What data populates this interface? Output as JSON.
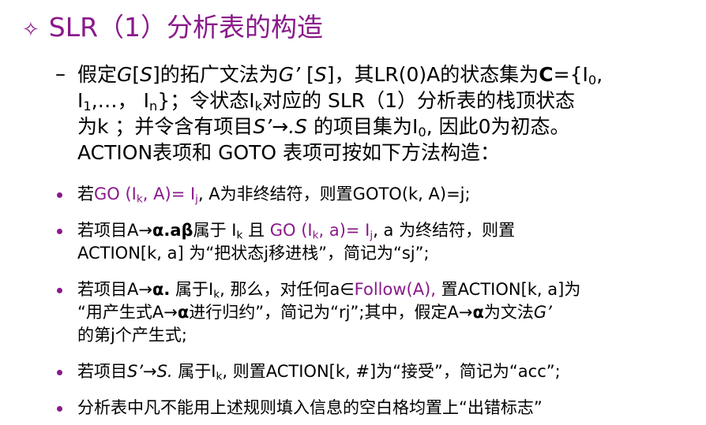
{
  "title": {
    "icon": "diamond-outline-icon",
    "text": "SLR（1）分析表的构造"
  },
  "intro": {
    "bullet": "–",
    "lines": [
      [
        "假定",
        "G",
        "[",
        "S",
        "]的拓广文法为",
        "G’",
        " [",
        "S",
        "]，其LR(0)A的状态集为",
        "C",
        "={I",
        "0",
        ","
      ],
      [
        "I",
        "1",
        ",…， I",
        "n",
        "}；令状态I",
        "k",
        "对应的 SLR（1）分析表的栈顶状态"
      ],
      [
        "为k ；并令含有项目",
        "S’→.S",
        " 的项目集为I",
        "0",
        ", 因此0为初态。"
      ],
      [
        "ACTION表项和 GOTO 表项可按如下方法构造："
      ]
    ]
  },
  "bullets": [
    {
      "lines": [
        [
          "若",
          "GO (I",
          "k",
          ", A)= I",
          "j",
          ", A为非终结符，则置GOTO(k, A)=j;"
        ]
      ]
    },
    {
      "lines": [
        [
          "若项目A→",
          "α.aβ",
          "属于 I",
          "k",
          " 且 ",
          "GO (I",
          "k",
          ", a)= I",
          "j",
          ", a 为终结符，则置"
        ],
        [
          "ACTION[k, a] 为“把状态j移进栈”，简记为“sj”;"
        ]
      ]
    },
    {
      "lines": [
        [
          "若项目A→",
          "α.",
          " 属于I",
          "k",
          ", 那么，对任何a∈",
          "Follow(A),",
          " 置ACTION[k, a]为"
        ],
        [
          "“用产生式A→",
          "α",
          "进行归约”，简记为“rj”;其中，假定A→",
          "α",
          "为文法",
          "G’"
        ],
        [
          "的第j个产生式;"
        ]
      ]
    },
    {
      "lines": [
        [
          "若项目",
          "S’→S.",
          " 属于I",
          "k",
          ", 则置ACTION[k, #]为“接受”，简记为“acc”;"
        ]
      ]
    },
    {
      "lines": [
        [
          "分析表中凡不能用上述规则填入信息的空白格均置上“出错标志”"
        ]
      ]
    }
  ],
  "colors": {
    "accent": "#8a1a8a",
    "text": "#000000"
  }
}
